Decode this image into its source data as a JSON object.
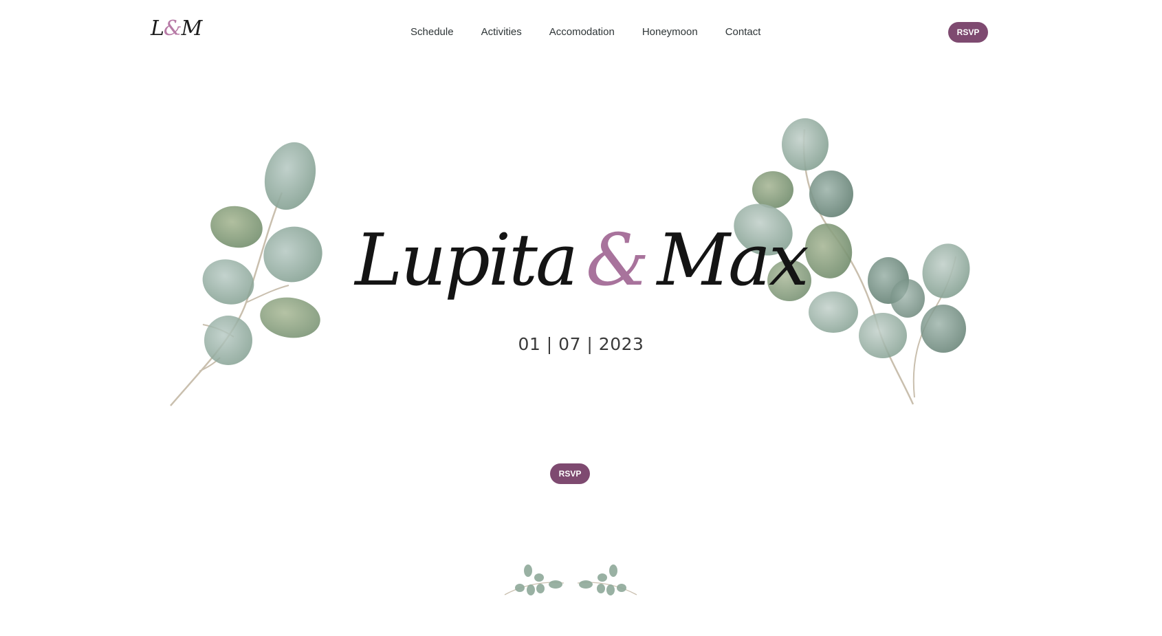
{
  "header": {
    "logo": {
      "first": "L",
      "amp": "&",
      "second": "M"
    },
    "nav": [
      {
        "label": "Schedule"
      },
      {
        "label": "Activities"
      },
      {
        "label": "Accomodation"
      },
      {
        "label": "Honeymoon"
      },
      {
        "label": "Contact"
      }
    ],
    "rsvp_label": "RSVP"
  },
  "hero": {
    "name_one": "Lupita",
    "amp": "&",
    "name_two": "Max",
    "date": "01 | 07 | 2023",
    "rsvp_label": "RSVP"
  },
  "colors": {
    "accent": "#7e4a70",
    "amp": "#a8739c",
    "leaf": "#8fa99a"
  },
  "icons": [
    "eucalyptus-branch-left",
    "eucalyptus-branch-right",
    "eucalyptus-divider"
  ]
}
